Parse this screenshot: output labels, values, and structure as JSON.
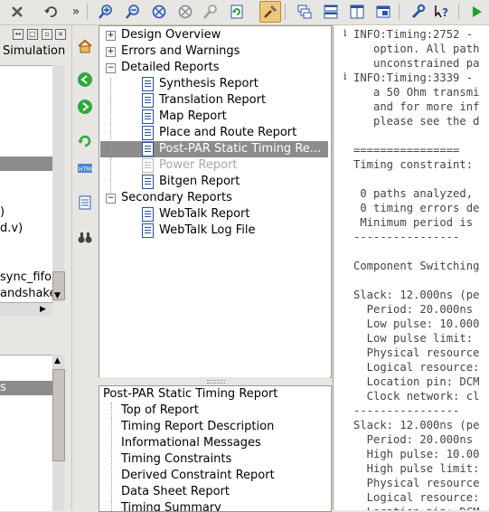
{
  "toolbar": {
    "buttons": [
      {
        "icon": "close-icon"
      },
      {
        "icon": "undo-icon"
      },
      {
        "icon": "overflow-chevron-icon",
        "glyph": "»"
      },
      {
        "icon": "zoom-in-icon"
      },
      {
        "icon": "zoom-out-icon"
      },
      {
        "icon": "zoom-full-icon"
      },
      {
        "icon": "zoom-fit-icon"
      },
      {
        "icon": "zoom-select-icon"
      },
      {
        "icon": "refresh-icon"
      },
      {
        "icon": "tool-active-icon"
      },
      {
        "icon": "cascade-windows-icon"
      },
      {
        "icon": "tile-horizontal-icon"
      },
      {
        "icon": "tile-vertical-icon"
      },
      {
        "icon": "floating-window-icon"
      },
      {
        "icon": "settings-wrench-icon"
      },
      {
        "icon": "help-icon"
      },
      {
        "icon": "run-icon"
      }
    ]
  },
  "left_panel": {
    "tab_label": "Simulation",
    "rows": [
      ")",
      "d.v)",
      "sync_fifo",
      "andshake"
    ],
    "highlight_label": "s"
  },
  "process_strip": {
    "buttons": [
      "design-home-icon",
      "back-arrow-icon",
      "forward-arrow-icon",
      "refresh-green-icon",
      "html-report-icon",
      "checklist-icon",
      "binoculars-icon"
    ]
  },
  "design_tree": {
    "nodes": [
      {
        "label": "Design Overview",
        "level": 0,
        "expander": "+"
      },
      {
        "label": "Errors and Warnings",
        "level": 0,
        "expander": "+"
      },
      {
        "label": "Detailed Reports",
        "level": 0,
        "expander": "−"
      },
      {
        "label": "Synthesis Report",
        "level": 1
      },
      {
        "label": "Translation Report",
        "level": 1
      },
      {
        "label": "Map Report",
        "level": 1
      },
      {
        "label": "Place and Route Report",
        "level": 1
      },
      {
        "label": "Post-PAR Static Timing Re...",
        "level": 1,
        "selected": true
      },
      {
        "label": "Power Report",
        "level": 1,
        "disabled": true
      },
      {
        "label": "Bitgen Report",
        "level": 1
      },
      {
        "label": "Secondary Reports",
        "level": 0,
        "expander": "−"
      },
      {
        "label": "WebTalk Report",
        "level": 1
      },
      {
        "label": "WebTalk Log File",
        "level": 1
      }
    ]
  },
  "outline": {
    "title": "Post-PAR Static Timing Report",
    "items": [
      "Top of Report",
      "Timing Report Description",
      "Informational Messages",
      "Timing Constraints",
      "Derived Constraint Report",
      "Data Sheet Report",
      "Timing Summary"
    ]
  },
  "report": {
    "lines": [
      {
        "text": "INFO:Timing:2752 - ",
        "info": true
      },
      {
        "text": "   option. All path"
      },
      {
        "text": "   unconstrained pa"
      },
      {
        "text": "INFO:Timing:3339 - ",
        "info": true
      },
      {
        "text": "   a 50 Ohm transmi"
      },
      {
        "text": "   and for more inf"
      },
      {
        "text": "   please see the d"
      },
      {
        "text": ""
      },
      {
        "text": "================"
      },
      {
        "text": "Timing constraint: "
      },
      {
        "text": ""
      },
      {
        "text": " 0 paths analyzed,"
      },
      {
        "text": " 0 timing errors de"
      },
      {
        "text": " Minimum period is "
      },
      {
        "text": "----------------"
      },
      {
        "text": ""
      },
      {
        "text": "Component Switching"
      },
      {
        "text": ""
      },
      {
        "text": "Slack: 12.000ns (pe"
      },
      {
        "text": "  Period: 20.000ns"
      },
      {
        "text": "  Low pulse: 10.000"
      },
      {
        "text": "  Low pulse limit: "
      },
      {
        "text": "  Physical resource"
      },
      {
        "text": "  Logical resource:"
      },
      {
        "text": "  Location pin: DCM"
      },
      {
        "text": "  Clock network: cl"
      },
      {
        "text": "----------------"
      },
      {
        "text": "Slack: 12.000ns (pe"
      },
      {
        "text": "  Period: 20.000ns"
      },
      {
        "text": "  High pulse: 10.00"
      },
      {
        "text": "  High pulse limit:"
      },
      {
        "text": "  Physical resource"
      },
      {
        "text": "  Logical resource:"
      },
      {
        "text": "  Location pin: DCM"
      }
    ]
  }
}
